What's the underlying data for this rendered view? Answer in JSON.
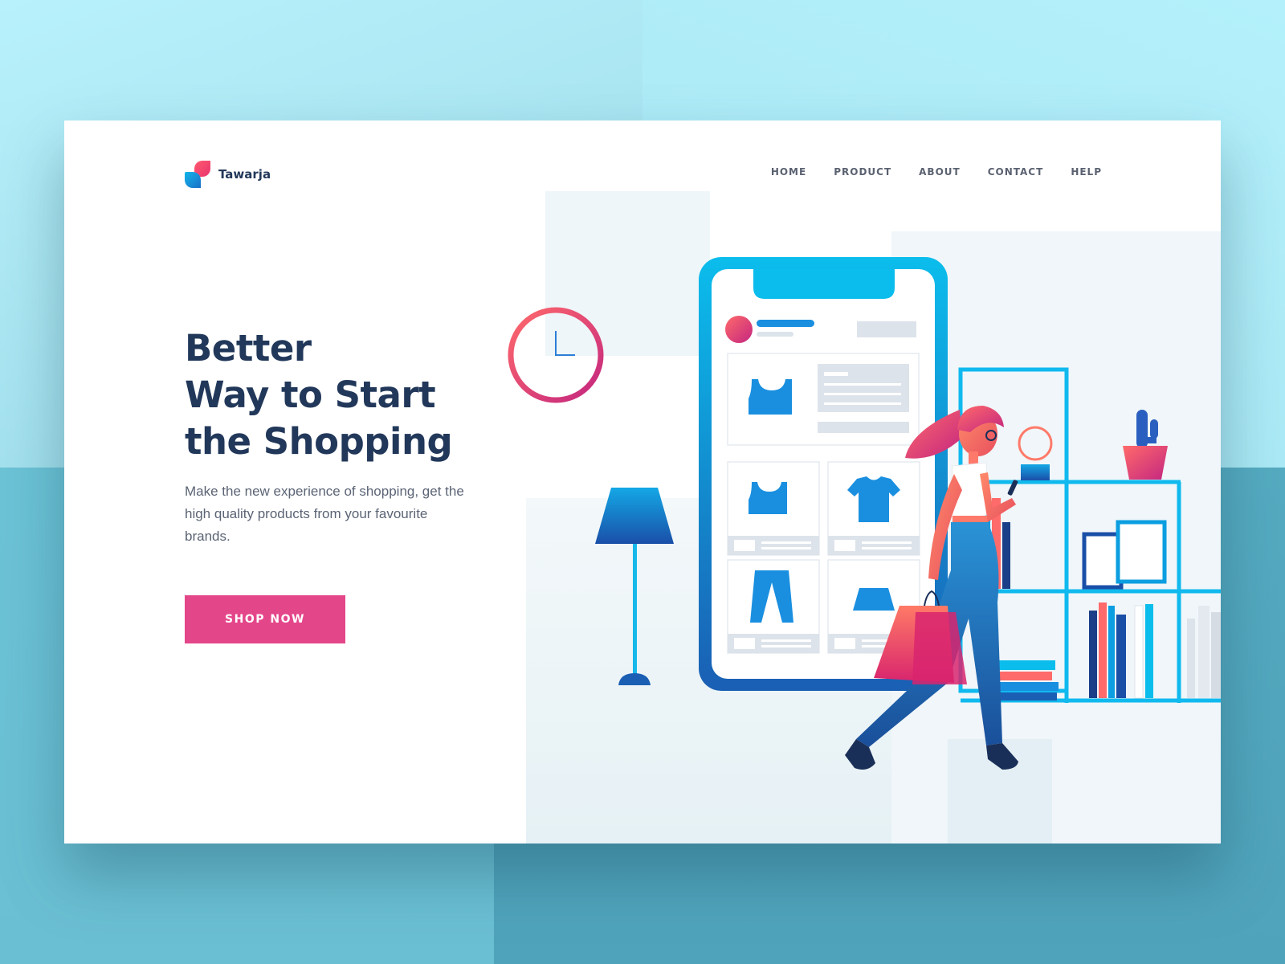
{
  "brand": {
    "name": "Tawarja"
  },
  "nav": {
    "items": [
      {
        "label": "HOME"
      },
      {
        "label": "PRODUCT"
      },
      {
        "label": "ABOUT"
      },
      {
        "label": "CONTACT"
      },
      {
        "label": "HELP"
      }
    ]
  },
  "hero": {
    "title_lines": [
      "Better",
      "Way to Start",
      "the Shopping"
    ],
    "description": "Make the new experience of shopping, get the high quality products from your favourite brands.",
    "cta_label": "SHOP NOW"
  },
  "icons": [
    "logo-mark-icon",
    "clock-icon",
    "floor-lamp-icon",
    "phone-icon",
    "tank-top-icon",
    "t-shirt-icon",
    "pants-icon",
    "skirt-icon",
    "shopping-bag-icon",
    "cactus-icon",
    "ring-icon"
  ],
  "colors": {
    "primary_text": "#22385a",
    "accent_pink": "#e4468a",
    "accent_blue": "#0bb5e8",
    "deep_blue": "#1a5fb4"
  }
}
